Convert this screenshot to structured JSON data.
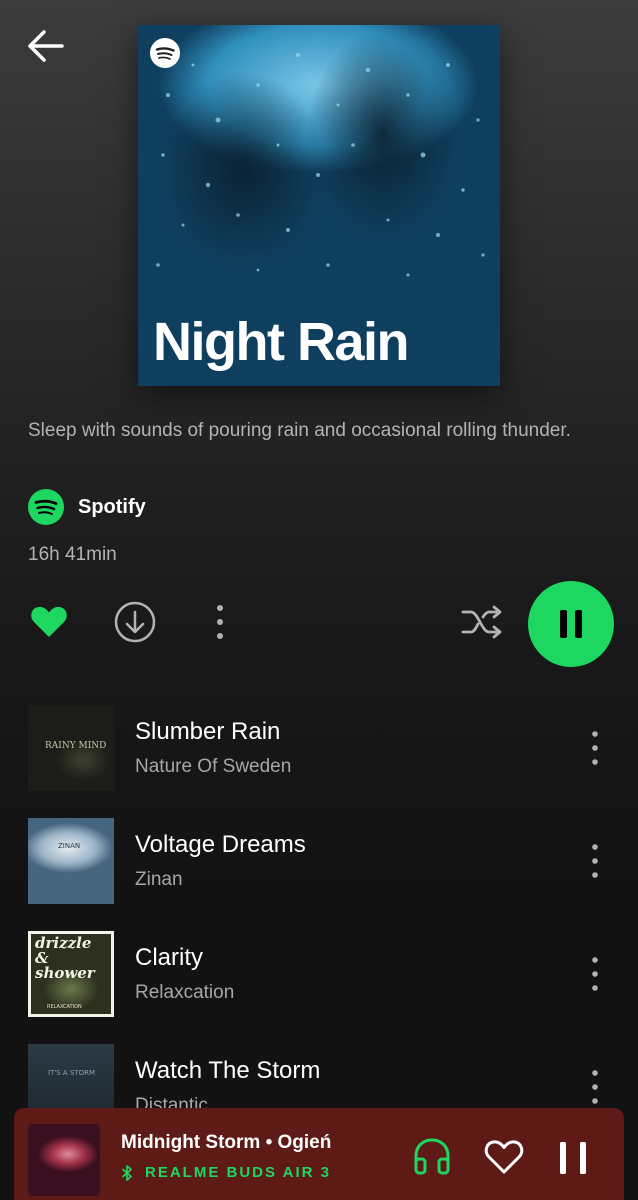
{
  "header": {
    "back_icon": "arrow-left-icon"
  },
  "playlist": {
    "cover_title": "Night Rain",
    "description": "Sleep with sounds of pouring rain and occasional rolling thunder.",
    "owner": "Spotify",
    "duration": "16h 41min"
  },
  "controls": {
    "liked": true,
    "icons": [
      "heart-icon",
      "download-icon",
      "more-vertical-icon",
      "shuffle-icon",
      "pause-icon"
    ]
  },
  "tracks": [
    {
      "title": "Slumber Rain",
      "artist": "Nature Of Sweden",
      "art_text": "RAINY MIND"
    },
    {
      "title": "Voltage Dreams",
      "artist": "Zinan",
      "art_text": "ZINAN"
    },
    {
      "title": "Clarity",
      "artist": "Relaxcation",
      "art_text": "drizzle & shower",
      "art_sub": "RELAXCATION"
    },
    {
      "title": "Watch The Storm",
      "artist": "Distantic",
      "art_text": "IT'S A STORM"
    }
  ],
  "now_playing": {
    "title": "Midnight Storm • Ogień",
    "device": "REALME BUDS AIR 3",
    "background_color": "#5e1a16"
  },
  "colors": {
    "accent_green": "#1ed760",
    "text_secondary": "#b3b3b3"
  }
}
